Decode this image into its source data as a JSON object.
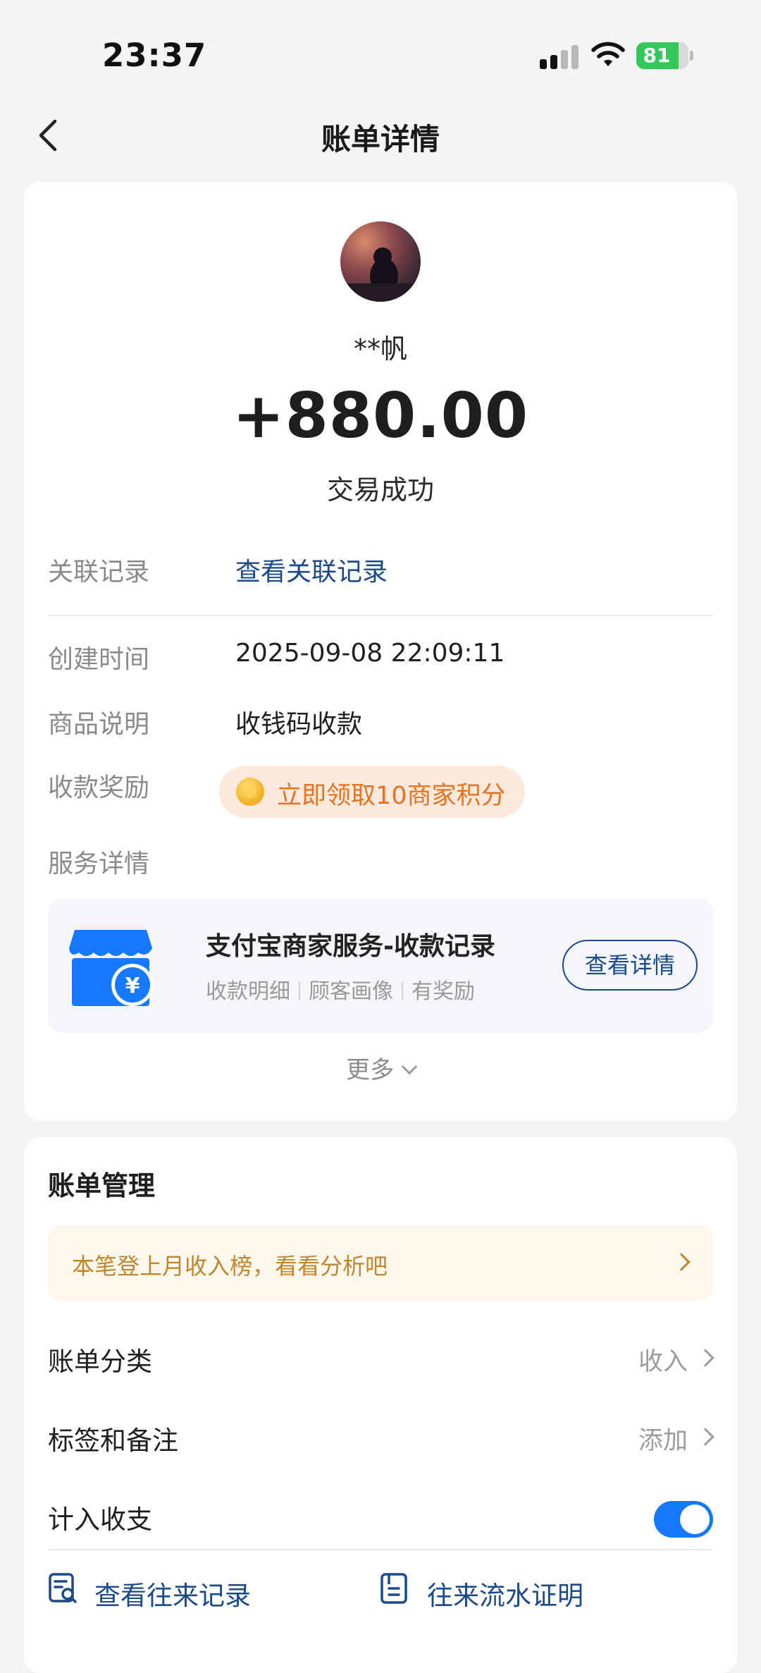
{
  "status_bar": {
    "time": "23:37",
    "battery": "81",
    "battery_level": 0.81,
    "battery_color": "#34c759"
  },
  "nav": {
    "back_icon": "chevron-left-icon",
    "title": "账单详情"
  },
  "transaction": {
    "name": "**帆",
    "amount": "+880.00",
    "status": "交易成功"
  },
  "details": {
    "related_label": "关联记录",
    "related_link": "查看关联记录",
    "created_label": "创建时间",
    "created_value": "2025-09-08 22:09:11",
    "product_label": "商品说明",
    "product_value": "收钱码收款",
    "reward_label": "收款奖励",
    "reward_text": "立即领取10商家积分",
    "service_label": "服务详情"
  },
  "service": {
    "title": "支付宝商家服务-收款记录",
    "tags": [
      "收款明细",
      "顾客画像",
      "有奖励"
    ],
    "button": "查看详情",
    "more": "更多"
  },
  "management": {
    "title": "账单管理",
    "banner": "本笔登上月收入榜，看看分析吧",
    "category_label": "账单分类",
    "category_value": "收入",
    "tags_label": "标签和备注",
    "tags_value": "添加",
    "count_label": "计入收支",
    "count_enabled": true,
    "view_records": "查看往来记录",
    "flow_proof": "往来流水证明"
  },
  "colors": {
    "link": "#1a4a8a",
    "accent": "#1677ff",
    "reward_text": "#e8731e",
    "banner_text": "#c0862e"
  }
}
